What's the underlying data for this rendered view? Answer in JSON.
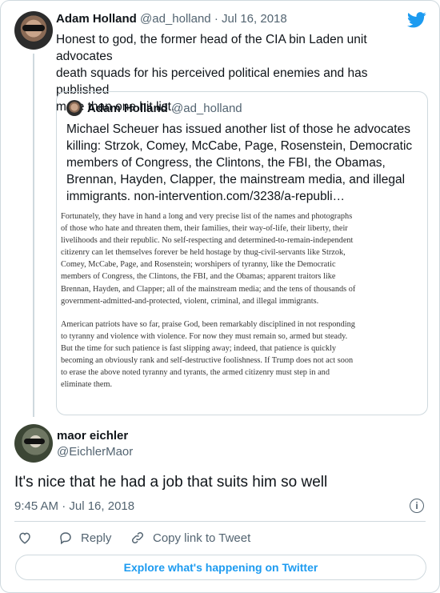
{
  "tweet": {
    "author_name": "Adam Holland",
    "author_handle": "@ad_holland",
    "separator": "·",
    "date": "Jul 16, 2018",
    "text_line1": "Honest to god, the former head of the CIA bin Laden unit advocates",
    "text_line2": "death squads for his perceived political enemies and has published",
    "text_line3": "more than one hit list.",
    "icon_bird": "twitter-bird-icon",
    "quoted": {
      "author_name": "Adam Holland",
      "author_handle": "@ad_holland",
      "text_line1": "Michael Scheuer has issued another list of those he advocates",
      "text_line2": "killing:  Strzok, Comey, McCabe, Page, Rosenstein, Democratic",
      "text_line3": "members of Congress, the Clintons, the FBI, the Obamas,",
      "text_line4": "Brennan, Hayden, Clapper, the mainstream media, and illegal",
      "text_line5": "immigrants. non-intervention.com/3238/a-republi…",
      "image_paragraph1": [
        "Fortunately, they have in hand a long and very precise list of the names and photographs",
        "of those who hate and threaten them, their families, their way-of-life, their liberty, their",
        "livelihoods and their republic. No self-respecting and determined-to-remain-independent",
        "citizenry can let themselves forever be held hostage by thug-civil-servants like Strzok,",
        "Comey, McCabe, Page, and Rosenstein; worshipers of tyranny, like the Democratic",
        "members of Congress, the Clintons, the FBI, and the Obamas; apparent traitors like",
        "Brennan, Hayden, and Clapper; all of the mainstream media; and the tens of thousands of",
        "government-admitted-and-protected, violent, criminal, and illegal immigrants."
      ],
      "image_paragraph2": [
        "American patriots have so far, praise God, been remarkably disciplined in not responding",
        "to tyranny and violence with violence. For now they must remain so, armed but steady.",
        "But the time for such patience is fast slipping away; indeed, that patience is quickly",
        "becoming an obviously rank and self-destructive foolishness. If Trump does not act soon",
        "to erase the above noted tyranny and tyrants, the armed citizenry must step in and",
        "eliminate them."
      ]
    }
  },
  "reply": {
    "author_name": "maor eichler",
    "author_handle": "@EichlerMaor",
    "text": "It's nice that he had a job that suits him so well",
    "timestamp": "9:45 AM · Jul 16, 2018",
    "info_icon": "info-icon",
    "info_glyph": "i"
  },
  "actions": {
    "like_icon": "heart-icon",
    "reply_label": "Reply",
    "reply_icon": "reply-icon",
    "copy_label": "Copy link to Tweet",
    "copy_icon": "link-icon"
  },
  "explore_label": "Explore what's happening on Twitter",
  "colors": {
    "accent": "#1d9bf0",
    "secondary_text": "#536471",
    "border": "#cfd9de"
  }
}
